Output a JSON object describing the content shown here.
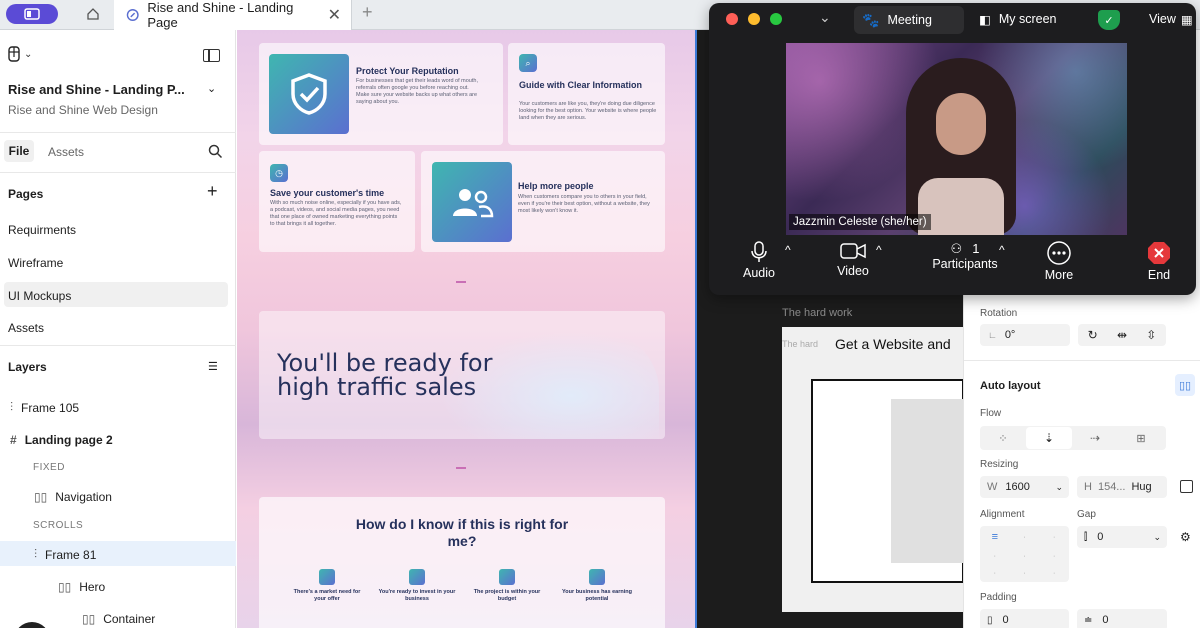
{
  "browser": {
    "tab_title": "Rise and Shine - Landing Page",
    "tab_close": "✕",
    "new_tab": "+"
  },
  "left_panel": {
    "file_title": "Rise and Shine - Landing P...",
    "file_subtitle": "Rise and Shine Web Design",
    "tabs": [
      "File",
      "Assets"
    ],
    "pages_label": "Pages",
    "pages": [
      "Requirments",
      "Wireframe",
      "UI Mockups",
      "Assets"
    ],
    "layers_label": "Layers",
    "layers": [
      {
        "name": "Frame 105",
        "icon": "frame"
      },
      {
        "name": "Landing page 2",
        "icon": "hash"
      },
      {
        "name": "FIXED",
        "icon": "section"
      },
      {
        "name": "Navigation",
        "icon": "autolayout"
      },
      {
        "name": "SCROLLS",
        "icon": "section"
      },
      {
        "name": "Frame 81",
        "icon": "frame"
      },
      {
        "name": "Hero",
        "icon": "autolayout"
      },
      {
        "name": "Container",
        "icon": "autolayout"
      }
    ]
  },
  "canvas": {
    "cards": [
      {
        "title": "Protect Your Reputation",
        "text": "For businesses that get their leads word of mouth, referrals often google you before reaching out.\nMake sure your website backs up what others are saying about you."
      },
      {
        "title": "Guide with Clear Information",
        "text": "Your customers are like you, they're doing due diligence looking for the best option. Your website is where people land when they are serious."
      },
      {
        "title": "Save your customer's time",
        "text": "With so much noise online, especially if you have ads, a podcast, videos, and social media pages, you need that one place of owned marketing everything points to that brings it all together."
      },
      {
        "title": "Help more people",
        "text": "When customers compare you to others in your field, even if you're their best option, without a website, they most likely won't know it."
      }
    ],
    "hero_heading": "You'll be ready for high traffic sales",
    "section_heading": "How do I know if this is right for me?",
    "bullets": [
      "There's a market need for your offer",
      "You're ready to invest in your business",
      "The project is within your budget",
      "Your business has earning potential"
    ]
  },
  "dark_canvas": {
    "label1": "The hard work",
    "label2": "The hard",
    "cta_text": "Get a Website and"
  },
  "zoom": {
    "dropdown": "⌄",
    "meeting_label": "Meeting",
    "screen_label": "My screen",
    "view_label": "View",
    "participant_name": "Jazzmin Celeste (she/her)",
    "controls": {
      "audio": "Audio",
      "video": "Video",
      "participants": "Participants",
      "participants_count": "1",
      "more": "More",
      "end": "End"
    }
  },
  "properties": {
    "rotation_label": "Rotation",
    "rotation_value": "0°",
    "auto_layout_label": "Auto layout",
    "flow_label": "Flow",
    "resizing_label": "Resizing",
    "width_prefix": "W",
    "width_value": "1600",
    "height_prefix": "H",
    "height_value": "154...",
    "height_mode": "Hug",
    "alignment_label": "Alignment",
    "gap_label": "Gap",
    "gap_value": "0",
    "padding_label": "Padding",
    "padding_h": "0",
    "padding_v": "0"
  },
  "colors": {
    "accent_purple": "#5b4bd6",
    "selection_blue": "#3d7bd9",
    "heading_navy": "#26315c",
    "zoom_end_red": "#e5383b"
  }
}
